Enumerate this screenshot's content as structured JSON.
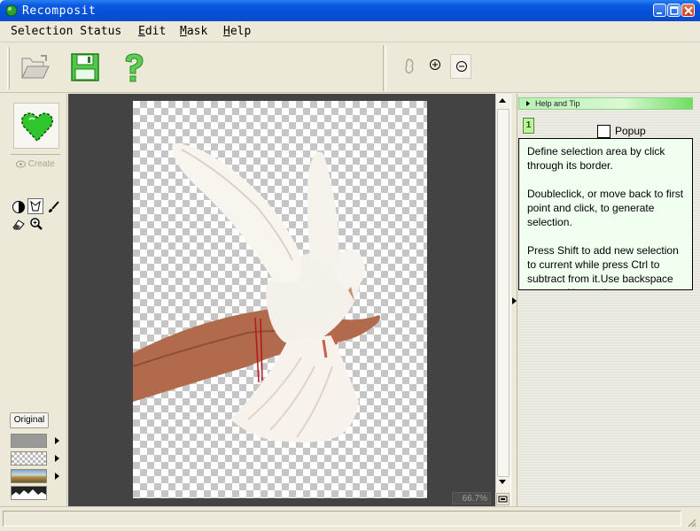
{
  "window": {
    "title": "Recomposit"
  },
  "menu": [
    {
      "accel": "",
      "rest": "Selection Status"
    },
    {
      "accel": "E",
      "rest": "dit"
    },
    {
      "accel": "M",
      "rest": "ask"
    },
    {
      "accel": "H",
      "rest": "elp"
    }
  ],
  "toolbar": {
    "open": "open-folder-icon",
    "save": "save-disk-icon",
    "help": "help-question-icon",
    "lasso": "lasso-hand-icon",
    "zoom_in": "zoom-in-icon",
    "zoom_out": "zoom-out-icon"
  },
  "left_panel": {
    "create_label": "Create",
    "original_label": "Original",
    "tools": [
      "color-picker-icon",
      "lasso-select-icon",
      "brush-icon",
      "eraser-icon",
      "magnifier-icon"
    ],
    "backgrounds": [
      "gray-background",
      "checker-background",
      "landscape-background",
      "silhouette-background"
    ]
  },
  "canvas": {
    "zoom_text": "66.7%"
  },
  "help_panel": {
    "header": "Help and Tip",
    "tip_icon_text": "1",
    "popup_label": "Popup",
    "popup_checked": false,
    "paragraphs": [
      "Define selection area by click through its border.",
      "Doubleclick, or move back to first point and click, to generate selection.",
      "Press Shift to add new selection to current while press Ctrl to subtract from it.Use backspace to cancel last point."
    ]
  },
  "colors": {
    "titlebar": "#0a5ae0",
    "canvas_bg": "#434343",
    "help_header": "#6fdd62",
    "tip_bg": "#f0fff0",
    "heart": "#2fc52c"
  }
}
